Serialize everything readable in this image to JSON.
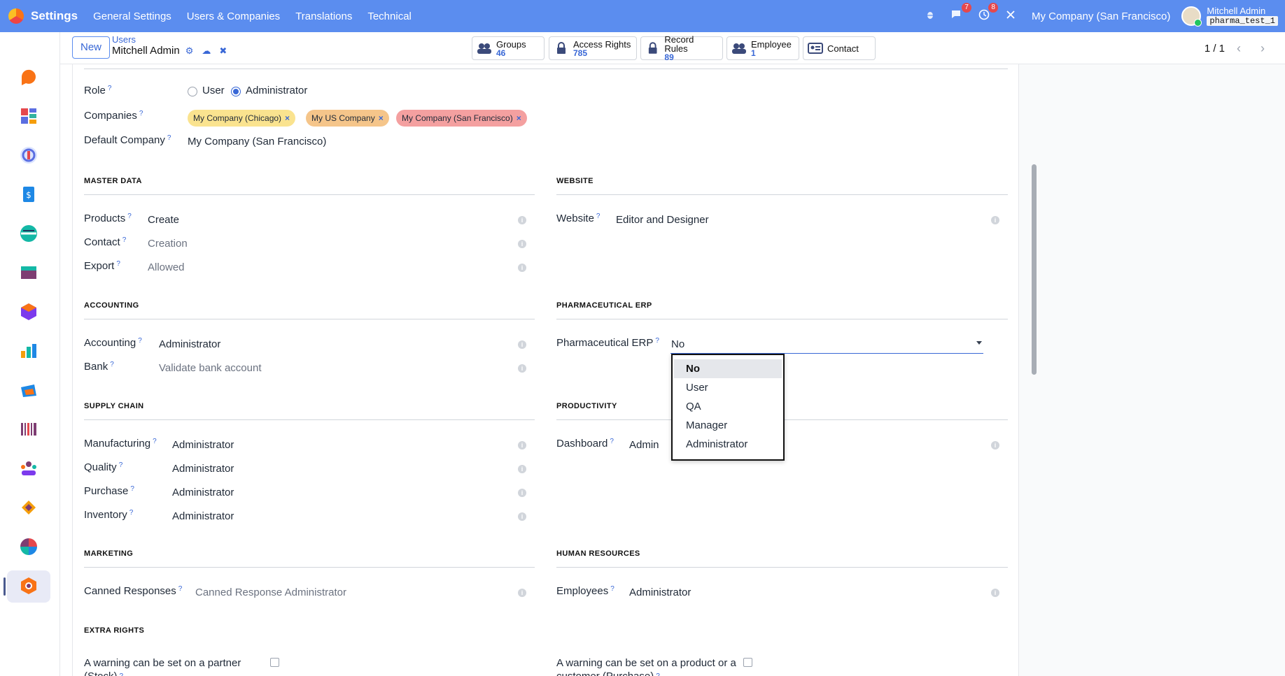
{
  "topbar": {
    "app_name": "Settings",
    "menus": [
      "General Settings",
      "Users & Companies",
      "Translations",
      "Technical"
    ],
    "chat_count": "7",
    "activity_count": "8",
    "company": "My Company (San Francisco)",
    "user_name": "Mitchell Admin",
    "database": "pharma_test_1"
  },
  "control": {
    "new_label": "New",
    "breadcrumb_parent": "Users",
    "breadcrumb_current": "Mitchell Admin",
    "pager": "1 / 1",
    "smart_buttons": [
      {
        "label": "Groups",
        "count": "46"
      },
      {
        "label": "Access Rights",
        "count": "785"
      },
      {
        "label": "Record Rules",
        "count": "89"
      },
      {
        "label": "Employee",
        "count": "1"
      },
      {
        "label": "Contact",
        "count": ""
      }
    ]
  },
  "form": {
    "role_label": "Role",
    "role_user": "User",
    "role_admin": "Administrator",
    "companies_label": "Companies",
    "companies": [
      "My Company (Chicago)",
      "My US Company",
      "My Company (San Francisco)"
    ],
    "default_company_label": "Default Company",
    "default_company": "My Company (San Francisco)",
    "sections": {
      "master_data": "MASTER DATA",
      "website": "WEBSITE",
      "accounting": "ACCOUNTING",
      "pharma": "PHARMACEUTICAL ERP",
      "supply_chain": "SUPPLY CHAIN",
      "productivity": "PRODUCTIVITY",
      "marketing": "MARKETING",
      "hr": "HUMAN RESOURCES",
      "extra": "EXTRA RIGHTS"
    },
    "fields": {
      "products": {
        "label": "Products",
        "value": "Create"
      },
      "contact": {
        "label": "Contact",
        "value": "Creation"
      },
      "export": {
        "label": "Export",
        "value": "Allowed"
      },
      "website": {
        "label": "Website",
        "value": "Editor and Designer"
      },
      "accounting": {
        "label": "Accounting",
        "value": "Administrator"
      },
      "bank": {
        "label": "Bank",
        "value": "Validate bank account"
      },
      "pharma": {
        "label": "Pharmaceutical ERP",
        "value": "No"
      },
      "manufacturing": {
        "label": "Manufacturing",
        "value": "Administrator"
      },
      "quality": {
        "label": "Quality",
        "value": "Administrator"
      },
      "purchase": {
        "label": "Purchase",
        "value": "Administrator"
      },
      "inventory": {
        "label": "Inventory",
        "value": "Administrator"
      },
      "dashboard": {
        "label": "Dashboard",
        "value": "Admin"
      },
      "canned": {
        "label": "Canned Responses",
        "value": "Canned Response Administrator"
      },
      "employees": {
        "label": "Employees",
        "value": "Administrator"
      }
    },
    "extra_left": "A warning can be set on a partner (Stock)",
    "extra_right": "A warning can be set on a product or a customer (Purchase)"
  },
  "dropdown": {
    "options": [
      "No",
      "User",
      "QA",
      "Manager",
      "Administrator"
    ],
    "selected": "No"
  }
}
